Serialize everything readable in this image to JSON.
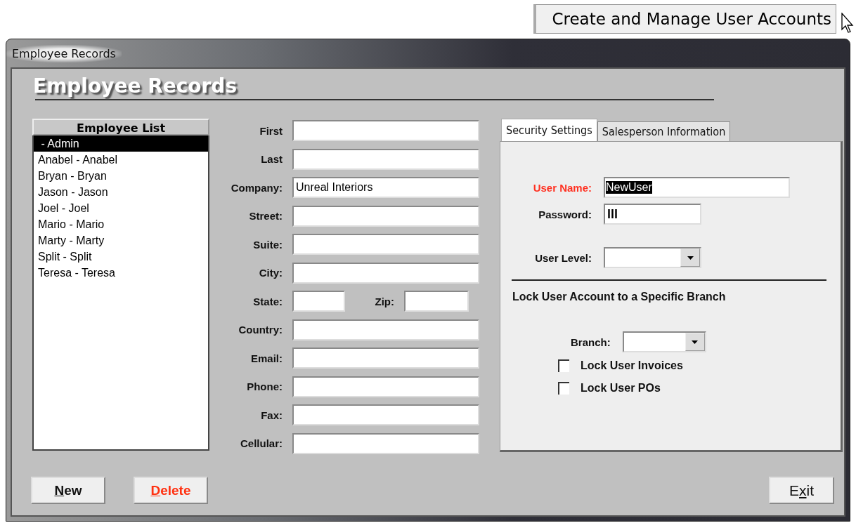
{
  "top_button": {
    "label": "Create and Manage User Accounts"
  },
  "window": {
    "title": "Employee Records"
  },
  "heading": "Employee Records",
  "employee_list": {
    "header": "Employee List",
    "items": [
      {
        "label": " - Admin",
        "selected": true
      },
      {
        "label": "Anabel - Anabel",
        "selected": false
      },
      {
        "label": "Bryan - Bryan",
        "selected": false
      },
      {
        "label": "Jason - Jason",
        "selected": false
      },
      {
        "label": "Joel - Joel",
        "selected": false
      },
      {
        "label": "Mario - Mario",
        "selected": false
      },
      {
        "label": "Marty - Marty",
        "selected": false
      },
      {
        "label": "Split - Split",
        "selected": false
      },
      {
        "label": "Teresa - Teresa",
        "selected": false
      }
    ]
  },
  "fields": [
    {
      "kind": "single",
      "label": "First"
    },
    {
      "kind": "single",
      "label": "Last"
    },
    {
      "kind": "single",
      "label": "Company:",
      "value": "Unreal Interiors"
    },
    {
      "kind": "single",
      "label": "Street:"
    },
    {
      "kind": "single",
      "label": "Suite:"
    },
    {
      "kind": "single",
      "label": "City:"
    },
    {
      "kind": "pair",
      "label": "State:",
      "label_2": "Zip:"
    },
    {
      "kind": "single",
      "label": "Country:"
    },
    {
      "kind": "single",
      "label": "Email:"
    },
    {
      "kind": "single",
      "label": "Phone:"
    },
    {
      "kind": "single",
      "label": "Fax:"
    },
    {
      "kind": "single",
      "label": "Cellular:"
    }
  ],
  "tabs": [
    {
      "label": "Security Settings",
      "selected": true
    },
    {
      "label": "Salesperson Information",
      "selected": false
    }
  ],
  "security": {
    "user_name": {
      "label": "User Name:",
      "value": "NewUser",
      "required": true
    },
    "password": {
      "label": "Password:",
      "value": "lll"
    },
    "user_level": {
      "label": "User Level:"
    },
    "branch_section": "Lock User Account to a Specific Branch",
    "branch": {
      "label": "Branch:"
    },
    "checkboxes": [
      {
        "label": "Lock User Invoices",
        "checked": false
      },
      {
        "label": "Lock User POs",
        "checked": false
      }
    ]
  },
  "buttons": [
    {
      "kind": "normal",
      "mnemonic": "N",
      "after": "ew"
    },
    {
      "kind": "danger",
      "mnemonic": "D",
      "after": "elete"
    },
    {
      "kind": "normal",
      "before": "E",
      "mnemonic": "x",
      "after": "it"
    }
  ]
}
